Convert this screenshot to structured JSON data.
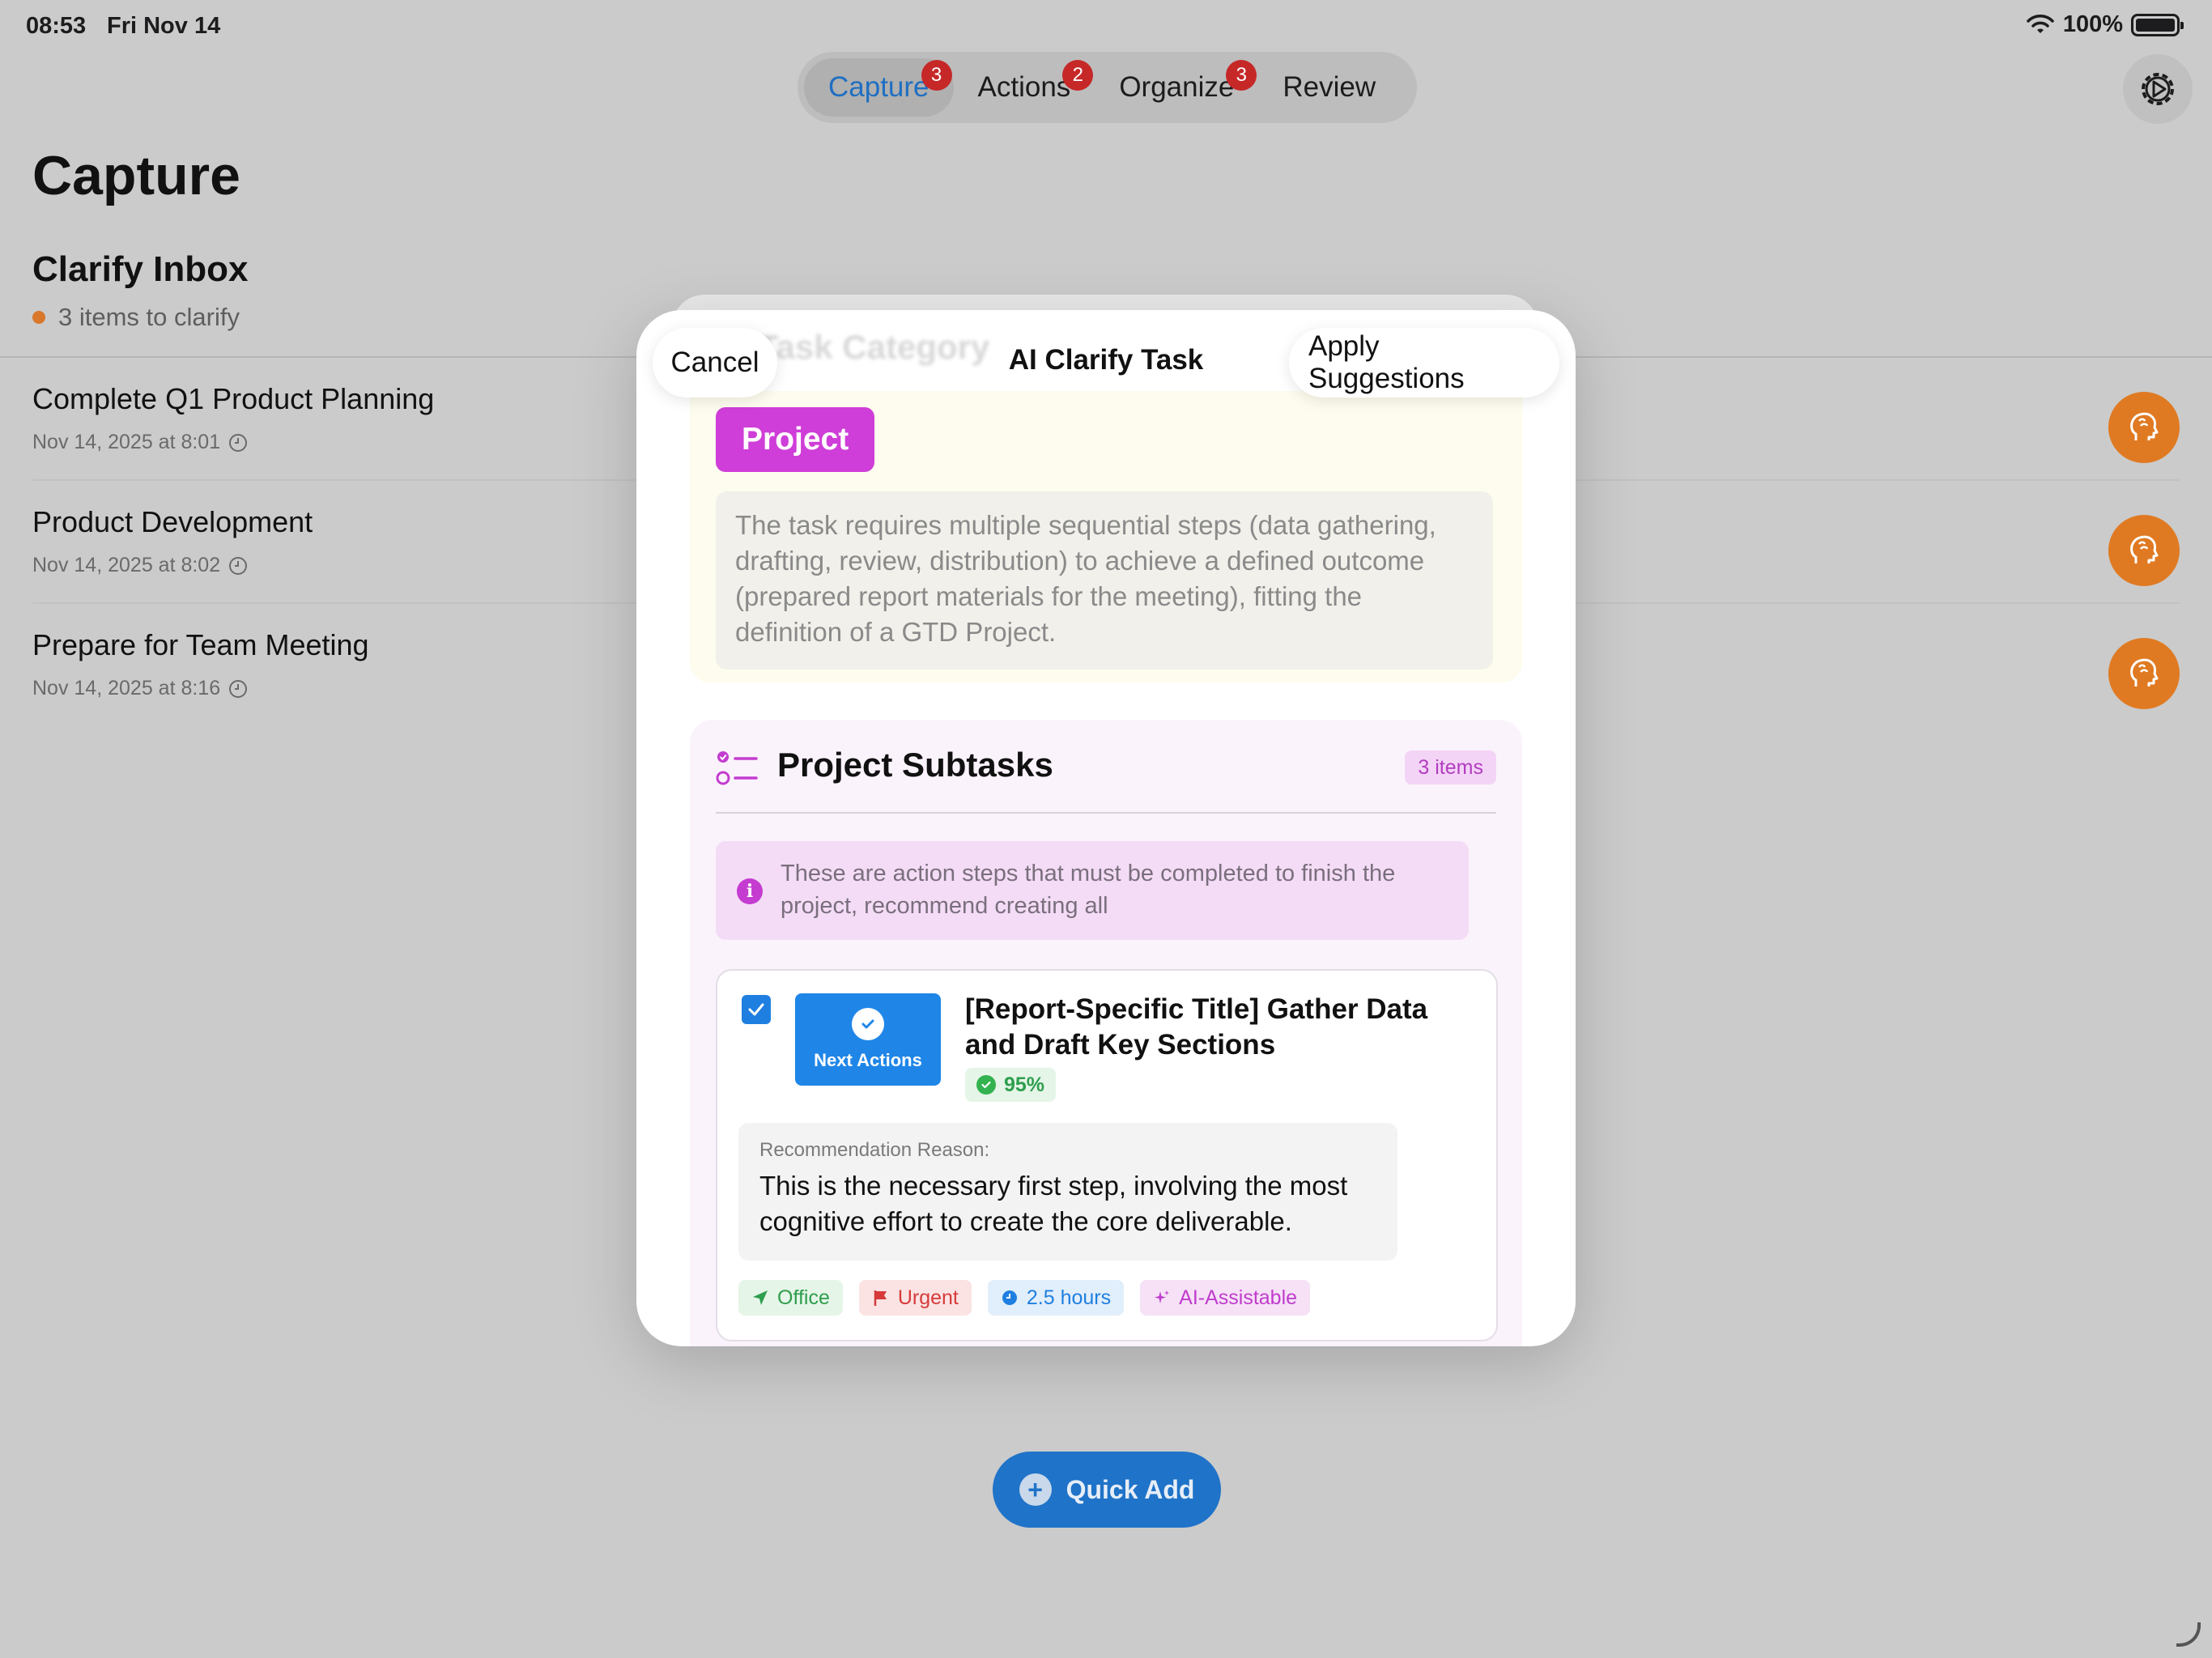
{
  "status_bar": {
    "time": "08:53",
    "date": "Fri Nov 14",
    "battery": "100%"
  },
  "tabs": [
    {
      "label": "Capture",
      "badge": "3",
      "active": true
    },
    {
      "label": "Actions",
      "badge": "2",
      "active": false
    },
    {
      "label": "Organize",
      "badge": "3",
      "active": false
    },
    {
      "label": "Review",
      "badge": "",
      "active": false
    }
  ],
  "page": {
    "title": "Capture"
  },
  "inbox": {
    "title": "Clarify Inbox",
    "subtitle": "3 items to clarify",
    "items": [
      {
        "title": "Complete Q1 Product Planning",
        "meta": "Nov 14, 2025 at 8:01"
      },
      {
        "title": "Product Development",
        "meta": "Nov 14, 2025 at 8:02"
      },
      {
        "title": "Prepare for Team Meeting",
        "meta": "Nov 14, 2025 at 8:16"
      }
    ]
  },
  "quick_add": {
    "label": "Quick Add"
  },
  "modal": {
    "title": "AI Clarify Task",
    "cancel_label": "Cancel",
    "apply_label": "Apply Suggestions",
    "ghost_header": "Task Category",
    "category": {
      "label": "Project",
      "reason": "The task requires multiple sequential steps (data gathering, drafting, review, distribution) to achieve a defined outcome (prepared report materials for the meeting), fitting the definition of a GTD Project."
    },
    "subtasks": {
      "title": "Project Subtasks",
      "count": "3 items",
      "info": "These are action steps that must be completed to finish the project, recommend creating all",
      "items": [
        {
          "checked": true,
          "category": "Next Actions",
          "title": "[Report-Specific Title] Gather Data and Draft Key Sections",
          "confidence": "95%",
          "reason_label": "Recommendation Reason:",
          "reason": "This is the necessary first step, involving the most cognitive effort to create the core deliverable.",
          "tags": {
            "context": "Office",
            "priority": "Urgent",
            "duration": "2.5 hours",
            "ai": "AI-Assistable"
          }
        }
      ]
    }
  },
  "colors": {
    "accent_blue": "#1f7fe0",
    "project_purple": "#cf3ed8",
    "badge_red": "#c62828",
    "clarify_orange": "#e07a22"
  }
}
